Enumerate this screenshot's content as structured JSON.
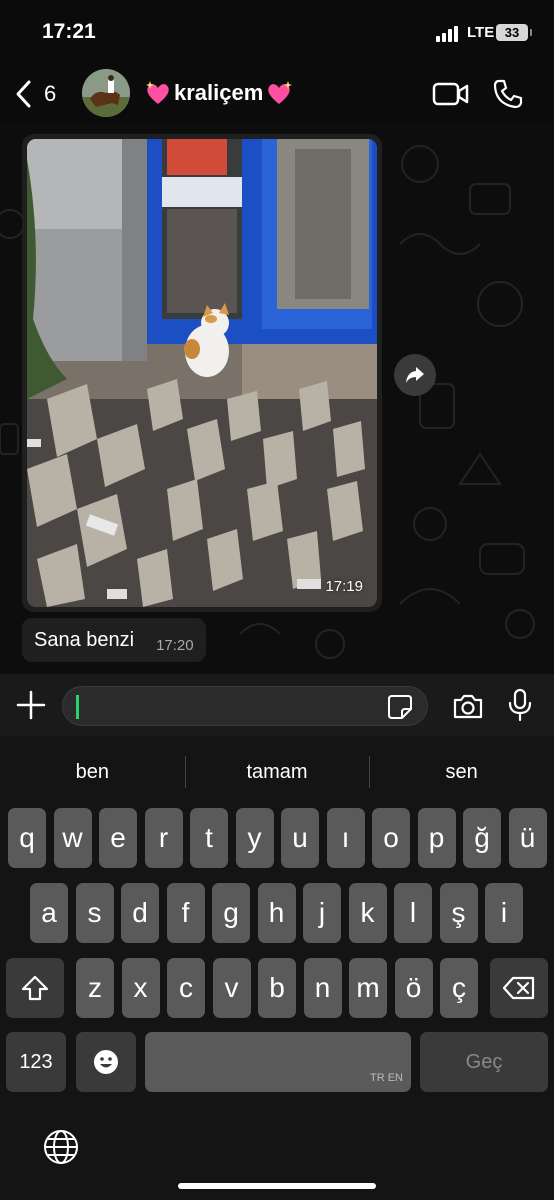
{
  "status": {
    "time": "17:21",
    "network": "LTE",
    "battery": "33"
  },
  "header": {
    "back_count": "6",
    "contact_name": "kraliçem"
  },
  "messages": [
    {
      "type": "image",
      "time": "17:19"
    },
    {
      "type": "text",
      "text": "Sana benzi",
      "time": "17:20"
    }
  ],
  "input": {
    "placeholder": ""
  },
  "keyboard": {
    "suggestions": [
      "ben",
      "tamam",
      "sen"
    ],
    "row1": [
      "q",
      "w",
      "e",
      "r",
      "t",
      "y",
      "u",
      "ı",
      "o",
      "p",
      "ğ",
      "ü"
    ],
    "row2": [
      "a",
      "s",
      "d",
      "f",
      "g",
      "h",
      "j",
      "k",
      "l",
      "ş",
      "i"
    ],
    "row3": [
      "z",
      "x",
      "c",
      "v",
      "b",
      "n",
      "m",
      "ö",
      "ç"
    ],
    "numbers_label": "123",
    "space_hint": "TR EN",
    "go_label": "Geç"
  }
}
